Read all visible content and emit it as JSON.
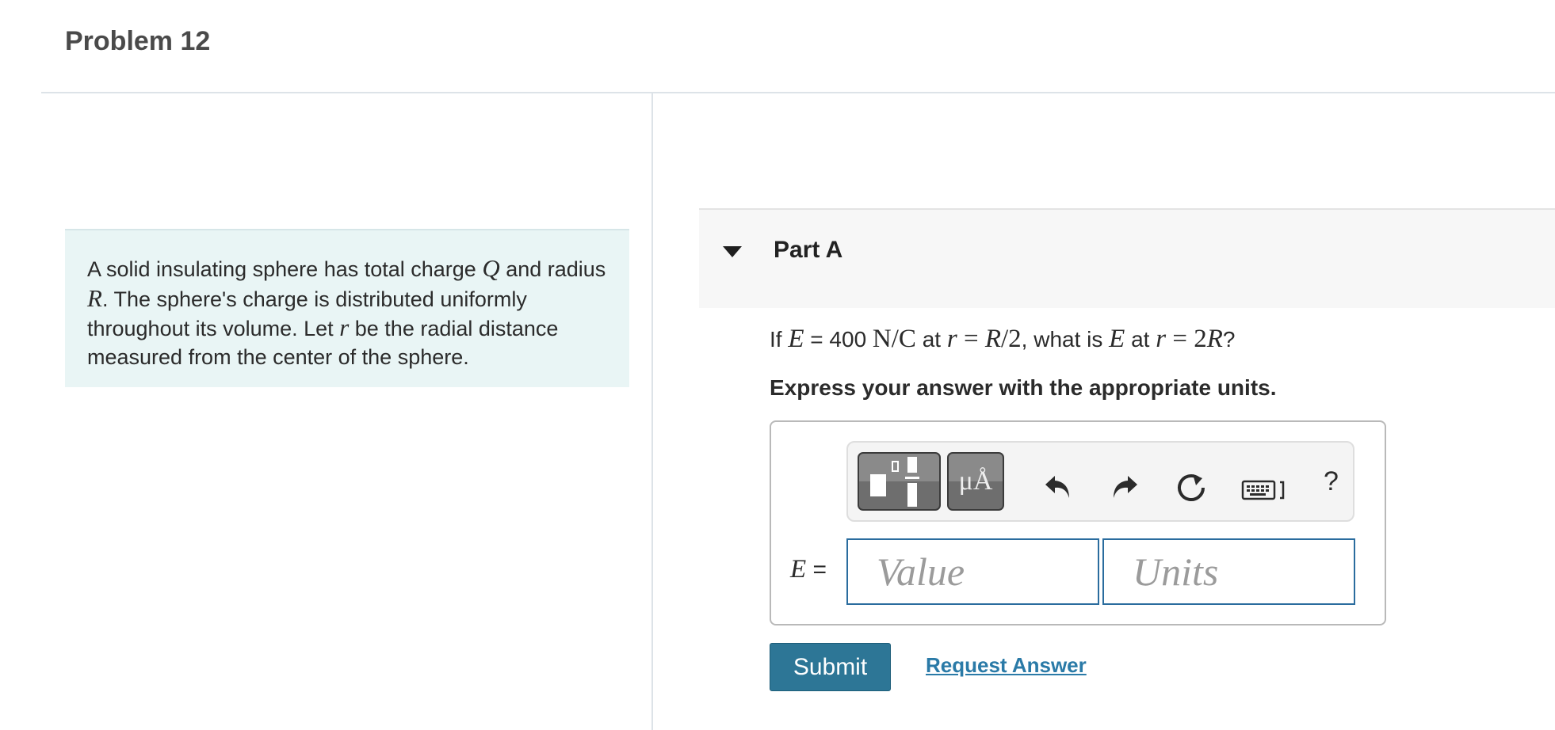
{
  "problem": {
    "title": "Problem 12"
  },
  "intro": {
    "t1": "A solid insulating sphere has total charge ",
    "Q": "Q",
    "t2": " and radius ",
    "R": "R",
    "t3": ". The sphere's charge is distributed uniformly throughout its volume. Let ",
    "r": "r",
    "t4": " be the radial distance measured from the center of the sphere."
  },
  "part": {
    "title": "Part A",
    "question": {
      "q1": "If ",
      "E1": "E",
      "q2": " = 400 ",
      "units": "N/C",
      "q3": " at ",
      "r1": "r",
      "eq1": " = ",
      "R1": "R",
      "half": "/2",
      "q4": ", what is ",
      "E2": "E",
      "q5": " at ",
      "r2": "r",
      "eq2": " = ",
      "two": "2",
      "R2": "R",
      "q6": "?"
    },
    "instruction": "Express your answer with the appropriate units."
  },
  "answer": {
    "label_var": "E",
    "label_eq": " =",
    "value_placeholder": "Value",
    "units_placeholder": "Units"
  },
  "toolbar": {
    "symbols_label": "μÅ",
    "help_label": "?",
    "icons": [
      "templates-icon",
      "symbols-icon",
      "undo-icon",
      "redo-icon",
      "reset-icon",
      "keyboard-icon",
      "help-icon"
    ]
  },
  "actions": {
    "submit_label": "Submit",
    "request_answer_label": "Request Answer"
  },
  "colors": {
    "intro_bg": "#e9f5f5",
    "submit_bg": "#2d7696",
    "link": "#2a7aa7",
    "input_border": "#2a6c9e"
  }
}
